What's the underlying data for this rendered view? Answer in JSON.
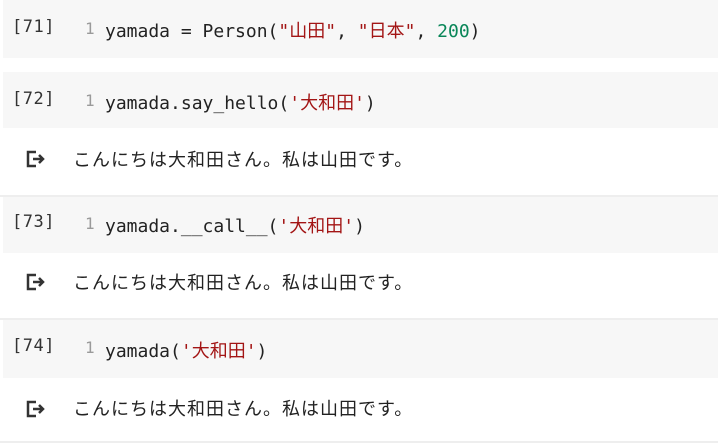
{
  "cells": [
    {
      "exec_count": "[71]",
      "line_number": "1",
      "code": {
        "prefix": "yamada = Person(",
        "str1": "\"山田\"",
        "sep1": ", ",
        "str2": "\"日本\"",
        "sep2": ", ",
        "num": "200",
        "suffix": ")"
      }
    },
    {
      "exec_count": "[72]",
      "line_number": "1",
      "code": {
        "prefix": "yamada.say_hello(",
        "str1": "'大和田'",
        "suffix": ")"
      },
      "output": "こんにちは大和田さん。私は山田です。"
    },
    {
      "exec_count": "[73]",
      "line_number": "1",
      "code": {
        "prefix": "yamada.__call__(",
        "str1": "'大和田'",
        "suffix": ")"
      },
      "output": "こんにちは大和田さん。私は山田です。"
    },
    {
      "exec_count": "[74]",
      "line_number": "1",
      "code": {
        "prefix": "yamada(",
        "str1": "'大和田'",
        "suffix": ")"
      },
      "output": "こんにちは大和田さん。私は山田です。"
    }
  ],
  "output_icon": "output-arrow-icon"
}
